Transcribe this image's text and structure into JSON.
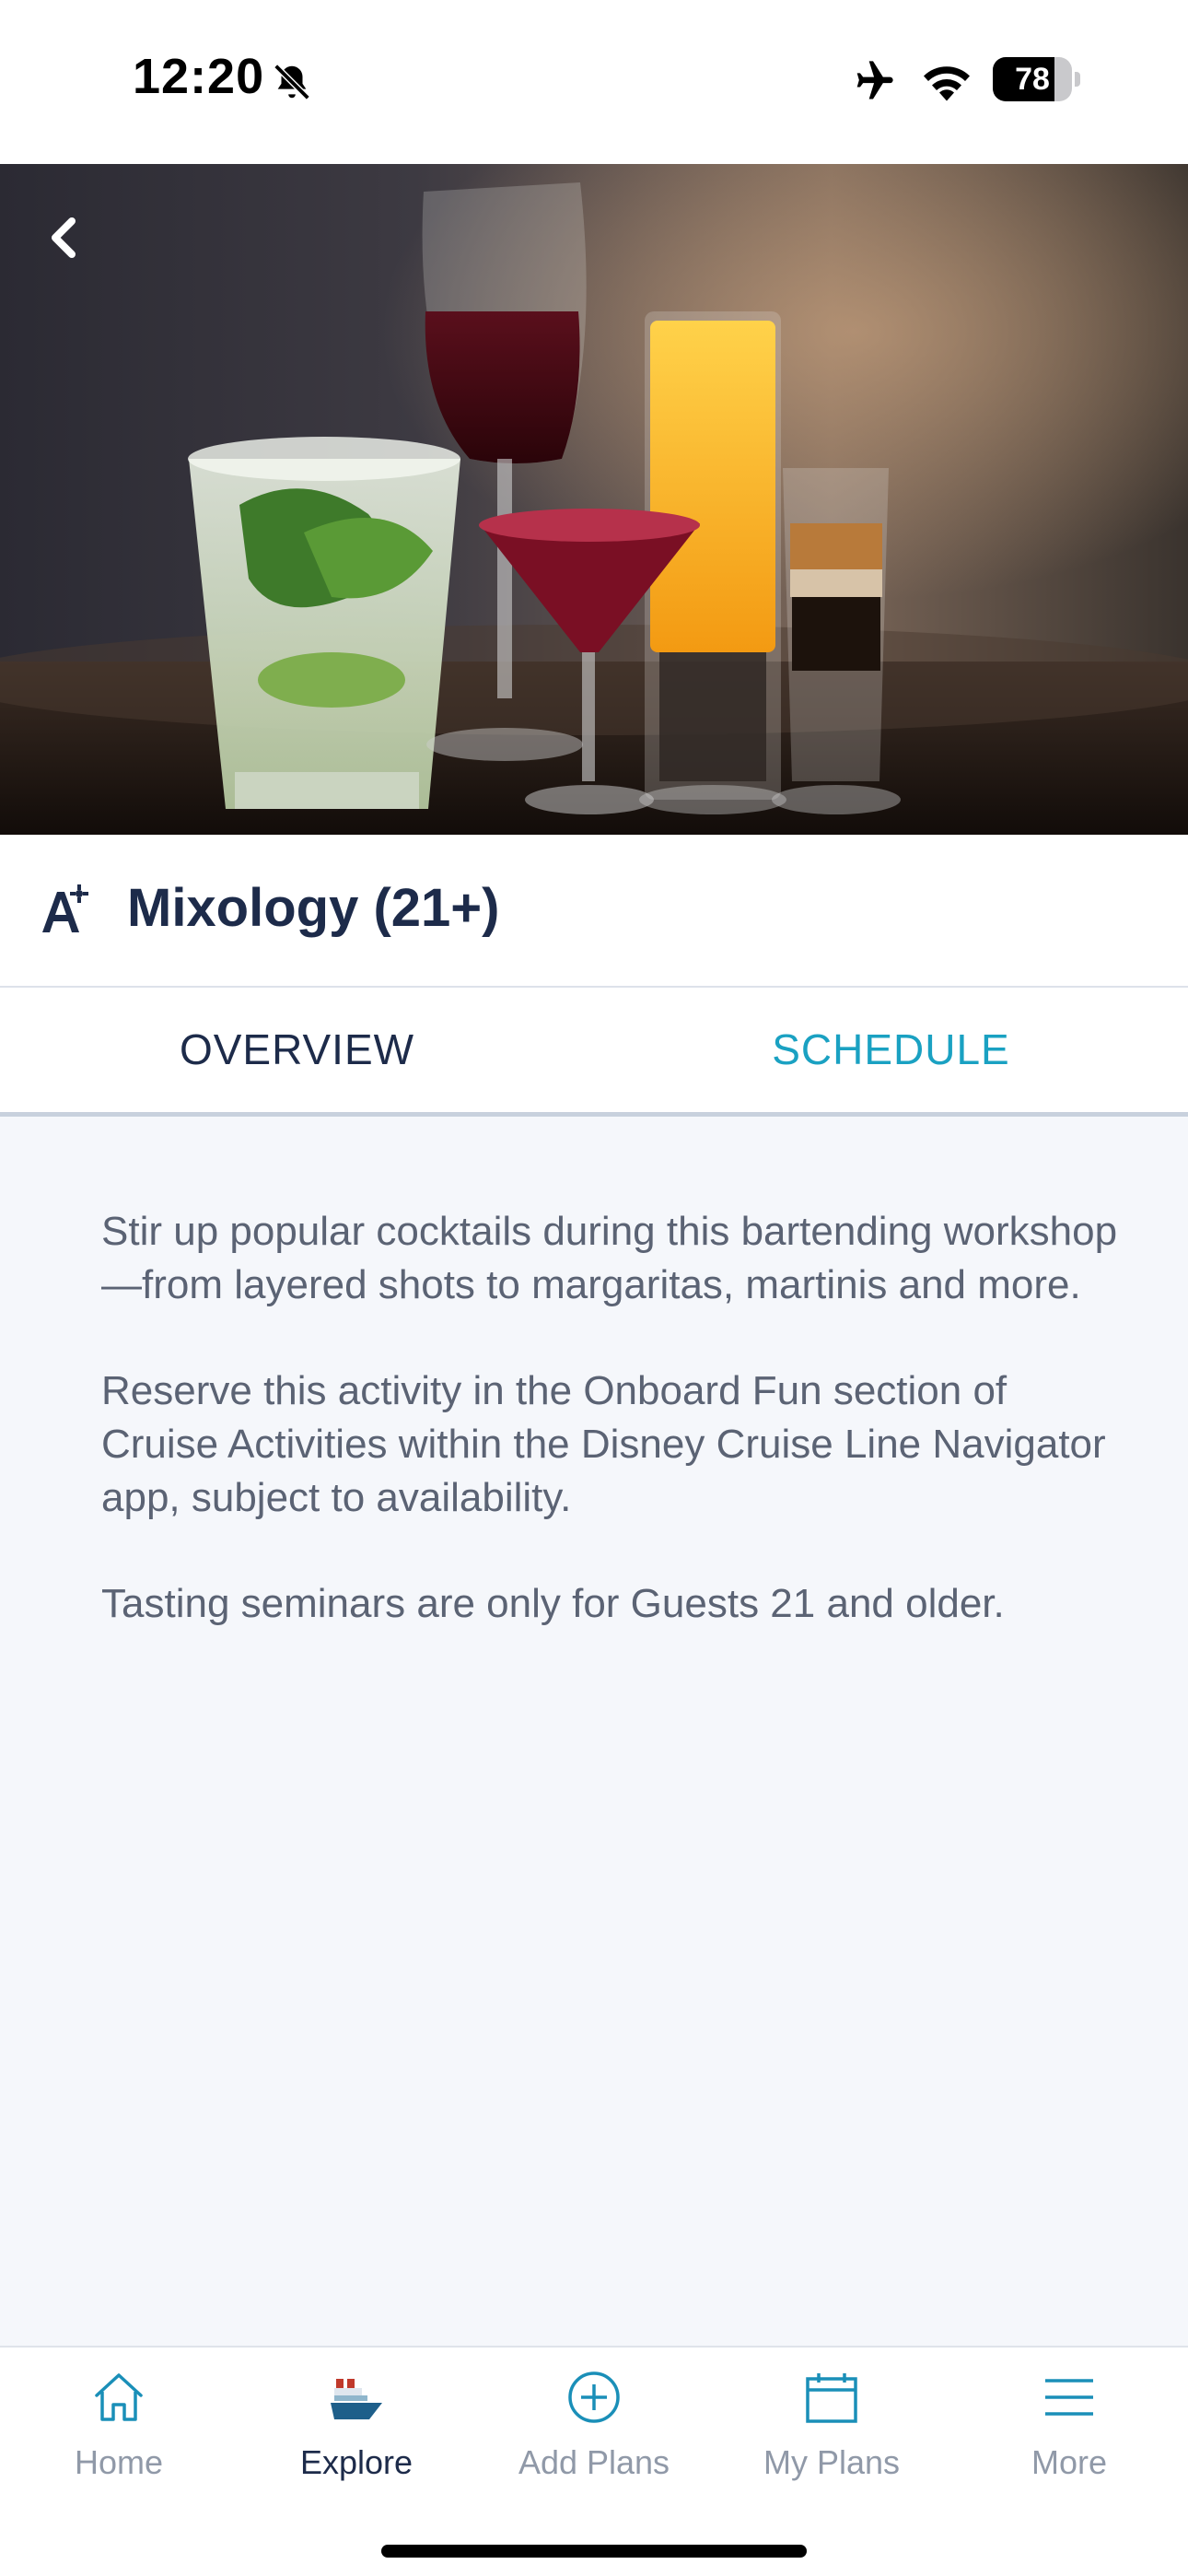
{
  "status_bar": {
    "time": "12:20",
    "battery": "78",
    "battery_level": 0.78,
    "icons": [
      "bell-off-icon",
      "airplane-icon",
      "wifi-icon",
      "battery-icon"
    ]
  },
  "hero": {
    "image": "cocktails-photo",
    "back_icon": "chevron-left-icon"
  },
  "activity": {
    "icon": "activity-sparkle-icon",
    "title": "Mixology (21+)"
  },
  "tabs": [
    {
      "label": "OVERVIEW",
      "selected": true
    },
    {
      "label": "SCHEDULE",
      "selected": false
    }
  ],
  "overview": {
    "paragraphs": [
      "Stir up popular cocktails during this bartending workshop—from layered shots to margaritas, martinis and more.",
      "Reserve this activity in the Onboard Fun section of Cruise Activities within the Disney Cruise Line Navigator app, subject to availability.",
      "Tasting seminars are only for Guests 21 and older."
    ]
  },
  "tab_bar": {
    "items": [
      {
        "label": "Home",
        "icon": "home-icon",
        "active": false
      },
      {
        "label": "Explore",
        "icon": "ship-icon",
        "active": true
      },
      {
        "label": "Add Plans",
        "icon": "plus-circle-icon",
        "active": false
      },
      {
        "label": "My Plans",
        "icon": "calendar-icon",
        "active": false
      },
      {
        "label": "More",
        "icon": "menu-icon",
        "active": false
      }
    ]
  },
  "colors": {
    "accent": "#1aa1c2",
    "navy": "#1d2b4a",
    "body_text": "#5b6374",
    "background": "#f5f7fb",
    "inactive_nav": "#9099a8"
  }
}
